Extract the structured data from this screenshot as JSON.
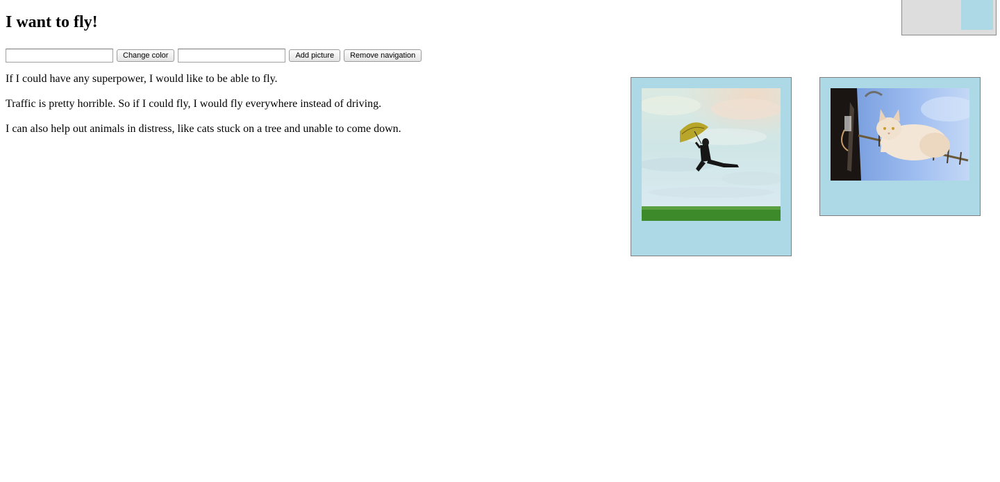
{
  "page": {
    "title": "I want to fly!"
  },
  "controls": {
    "color_input_value": "",
    "change_color_label": "Change color",
    "picture_input_value": "",
    "add_picture_label": "Add picture",
    "remove_navigation_label": "Remove navigation"
  },
  "content": {
    "paragraphs": [
      "If I could have any superpower, I would like to be able to fly.",
      "Traffic is pretty horrible. So if I could fly, I would fly everywhere instead of driving.",
      "I can also help out animals in distress, like cats stuck on a tree and unable to come down."
    ]
  },
  "pictures": [
    {
      "name": "man-with-umbrella-flying-image"
    },
    {
      "name": "cat-on-antenna-image"
    }
  ],
  "colors": {
    "frame_background": "#add8e6",
    "nav_background": "#dddddd",
    "nav_swatch": "#add8e6"
  }
}
